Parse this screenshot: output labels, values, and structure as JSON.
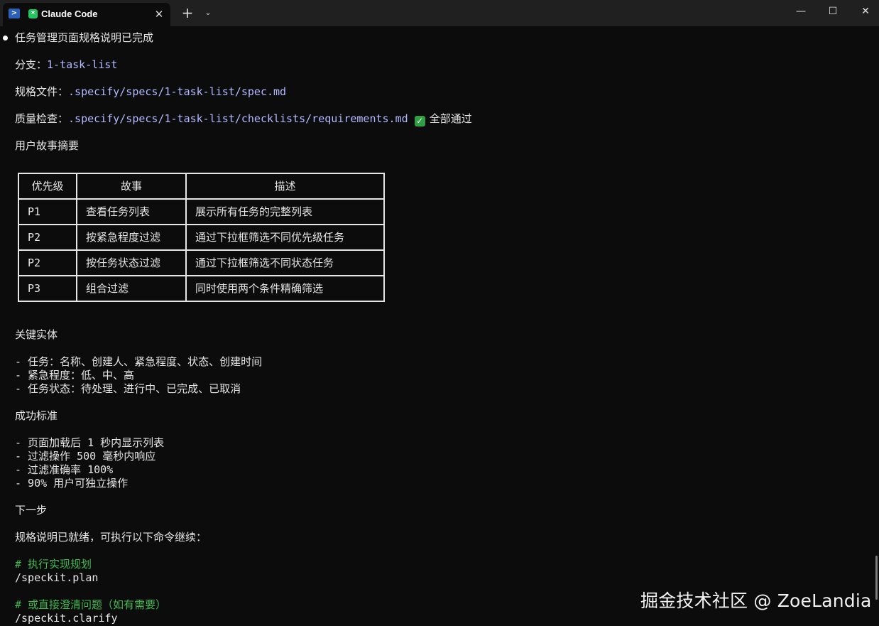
{
  "window": {
    "tab_title": "Claude Code",
    "tab_close": "✕",
    "new_tab": "+",
    "dropdown": "⌄",
    "minimize": "—",
    "maximize": "☐",
    "close": "✕"
  },
  "output": {
    "heading": "任务管理页面规格说明已完成",
    "branch_label": "分支：",
    "branch_value": "1-task-list",
    "spec_label": "规格文件：",
    "spec_value": ".specify/specs/1-task-list/spec.md",
    "quality_label": "质量检查：",
    "quality_value": ".specify/specs/1-task-list/checklists/requirements.md",
    "quality_check_glyph": "✓",
    "quality_status": "全部通过",
    "stories_title": "用户故事摘要",
    "table": {
      "headers": [
        "优先级",
        "故事",
        "描述"
      ],
      "rows": [
        [
          "P1",
          "查看任务列表",
          "展示所有任务的完整列表"
        ],
        [
          "P2",
          "按紧急程度过滤",
          "通过下拉框筛选不同优先级任务"
        ],
        [
          "P2",
          "按任务状态过滤",
          "通过下拉框筛选不同状态任务"
        ],
        [
          "P3",
          "组合过滤",
          "同时使用两个条件精确筛选"
        ]
      ]
    },
    "entities_title": "关键实体",
    "entities": [
      "- 任务：名称、创建人、紧急程度、状态、创建时间",
      "- 紧急程度：低、中、高",
      "- 任务状态：待处理、进行中、已完成、已取消"
    ],
    "criteria_title": "成功标准",
    "criteria": [
      "- 页面加载后 1 秒内显示列表",
      "- 过滤操作 500 毫秒内响应",
      "- 过滤准确率 100%",
      "- 90% 用户可独立操作"
    ],
    "next_title": "下一步",
    "next_desc": "规格说明已就绪，可执行以下命令继续：",
    "comment_plan": "# 执行实现规划",
    "cmd_plan": "/speckit.plan",
    "comment_clarify": "# 或直接澄清问题（如有需要）",
    "cmd_clarify": "/speckit.clarify"
  },
  "watermark": "掘金技术社区 @ ZoeLandia"
}
